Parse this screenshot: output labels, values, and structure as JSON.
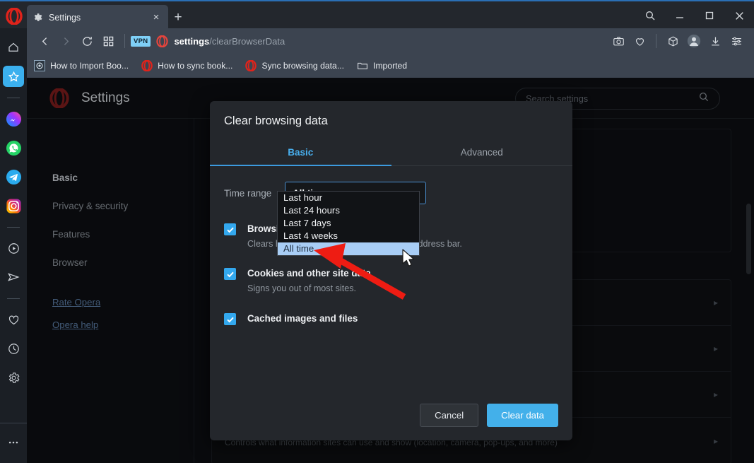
{
  "browser": {
    "tab": {
      "title": "Settings",
      "favicon": "gear-icon",
      "close": "×"
    },
    "new_tab_label": "+",
    "window_controls": {
      "search": "search-icon",
      "minimize": "minimize-icon",
      "maximize": "maximize-icon",
      "close": "close-icon"
    },
    "nav": {
      "back": "back-arrow-icon",
      "forward": "forward-arrow-icon",
      "reload": "reload-icon",
      "tab_grid": "tab-grid-icon",
      "vpn_badge": "VPN",
      "site_icon": "opera-icon",
      "address_bold": "settings",
      "address_rest": "/clearBrowserData"
    },
    "nav_right_icons": [
      "camera-icon",
      "heart-icon",
      "cube-icon",
      "avatar-icon",
      "download-icon",
      "easy-setup-icon"
    ],
    "bookmarks": [
      {
        "label": "How to Import Boo...",
        "icon": "picture-icon"
      },
      {
        "label": "How to sync book...",
        "icon": "opera-icon"
      },
      {
        "label": "Sync browsing data...",
        "icon": "opera-icon"
      },
      {
        "label": "Imported",
        "icon": "folder-icon"
      }
    ]
  },
  "sidebar": {
    "items": [
      {
        "name": "home",
        "icon": "home-icon",
        "active": false
      },
      {
        "name": "bookmarks",
        "icon": "star-icon",
        "active": true
      },
      {
        "name": "messenger",
        "icon": "messenger-icon",
        "active": false
      },
      {
        "name": "whatsapp",
        "icon": "whatsapp-icon",
        "active": false
      },
      {
        "name": "telegram",
        "icon": "telegram-icon",
        "active": false
      },
      {
        "name": "instagram",
        "icon": "instagram-icon",
        "active": false
      },
      {
        "name": "player",
        "icon": "play-circle-icon",
        "active": false
      },
      {
        "name": "send",
        "icon": "paper-plane-icon",
        "active": false
      },
      {
        "name": "favorites",
        "icon": "heart-outline-icon",
        "active": false
      },
      {
        "name": "history",
        "icon": "clock-icon",
        "active": false
      },
      {
        "name": "settings",
        "icon": "gear-icon",
        "active": false
      },
      {
        "name": "more",
        "icon": "ellipsis-icon",
        "active": false
      }
    ]
  },
  "settings_page": {
    "brand_icon": "opera-icon",
    "title": "Settings",
    "search": {
      "placeholder": "Search settings",
      "icon": "search-icon"
    },
    "nav_items": [
      {
        "label": "Basic",
        "selected": true
      },
      {
        "label": "Privacy & security",
        "selected": false
      },
      {
        "label": "Features",
        "selected": false
      },
      {
        "label": "Browser",
        "selected": false
      }
    ],
    "external_links": [
      {
        "label": "Rate Opera"
      },
      {
        "label": "Opera help"
      }
    ],
    "rows": [
      {
        "title": "",
        "sub": "",
        "chevron": "▸"
      },
      {
        "title": "",
        "sub": "",
        "chevron": "▸"
      },
      {
        "title": "",
        "sub": "",
        "chevron": "▸"
      },
      {
        "title": "",
        "sub": "Controls what information sites can use and show (location, camera, pop-ups, and more)",
        "chevron": "▸"
      }
    ]
  },
  "dialog": {
    "title": "Clear browsing data",
    "tabs": [
      {
        "label": "Basic",
        "active": true
      },
      {
        "label": "Advanced",
        "active": false
      }
    ],
    "time_range": {
      "label": "Time range",
      "selected": "All time",
      "caret": "chevron-down-icon",
      "options": [
        {
          "label": "Last hour",
          "highlighted": false
        },
        {
          "label": "Last 24 hours",
          "highlighted": false
        },
        {
          "label": "Last 7 days",
          "highlighted": false
        },
        {
          "label": "Last 4 weeks",
          "highlighted": false
        },
        {
          "label": "All time",
          "highlighted": true
        }
      ]
    },
    "checkboxes": [
      {
        "title": "Browsing history",
        "sub": "Clears history and autocompletions in the address bar.",
        "checked": true
      },
      {
        "title": "Cookies and other site data",
        "sub": "Signs you out of most sites.",
        "checked": true
      },
      {
        "title": "Cached images and files",
        "sub": "",
        "checked": true
      }
    ],
    "buttons": {
      "cancel": "Cancel",
      "confirm": "Clear data"
    }
  },
  "annotation": {
    "arrow_color": "#ee1c13",
    "cursor": "arrow-pointer"
  },
  "colors": {
    "accent": "#43b0ea",
    "chrome": "#3c4450",
    "titlebar": "#23272d",
    "page_bg": "#0d0f12",
    "dialog_bg": "#24272c",
    "highlight": "#a8cdf5"
  }
}
